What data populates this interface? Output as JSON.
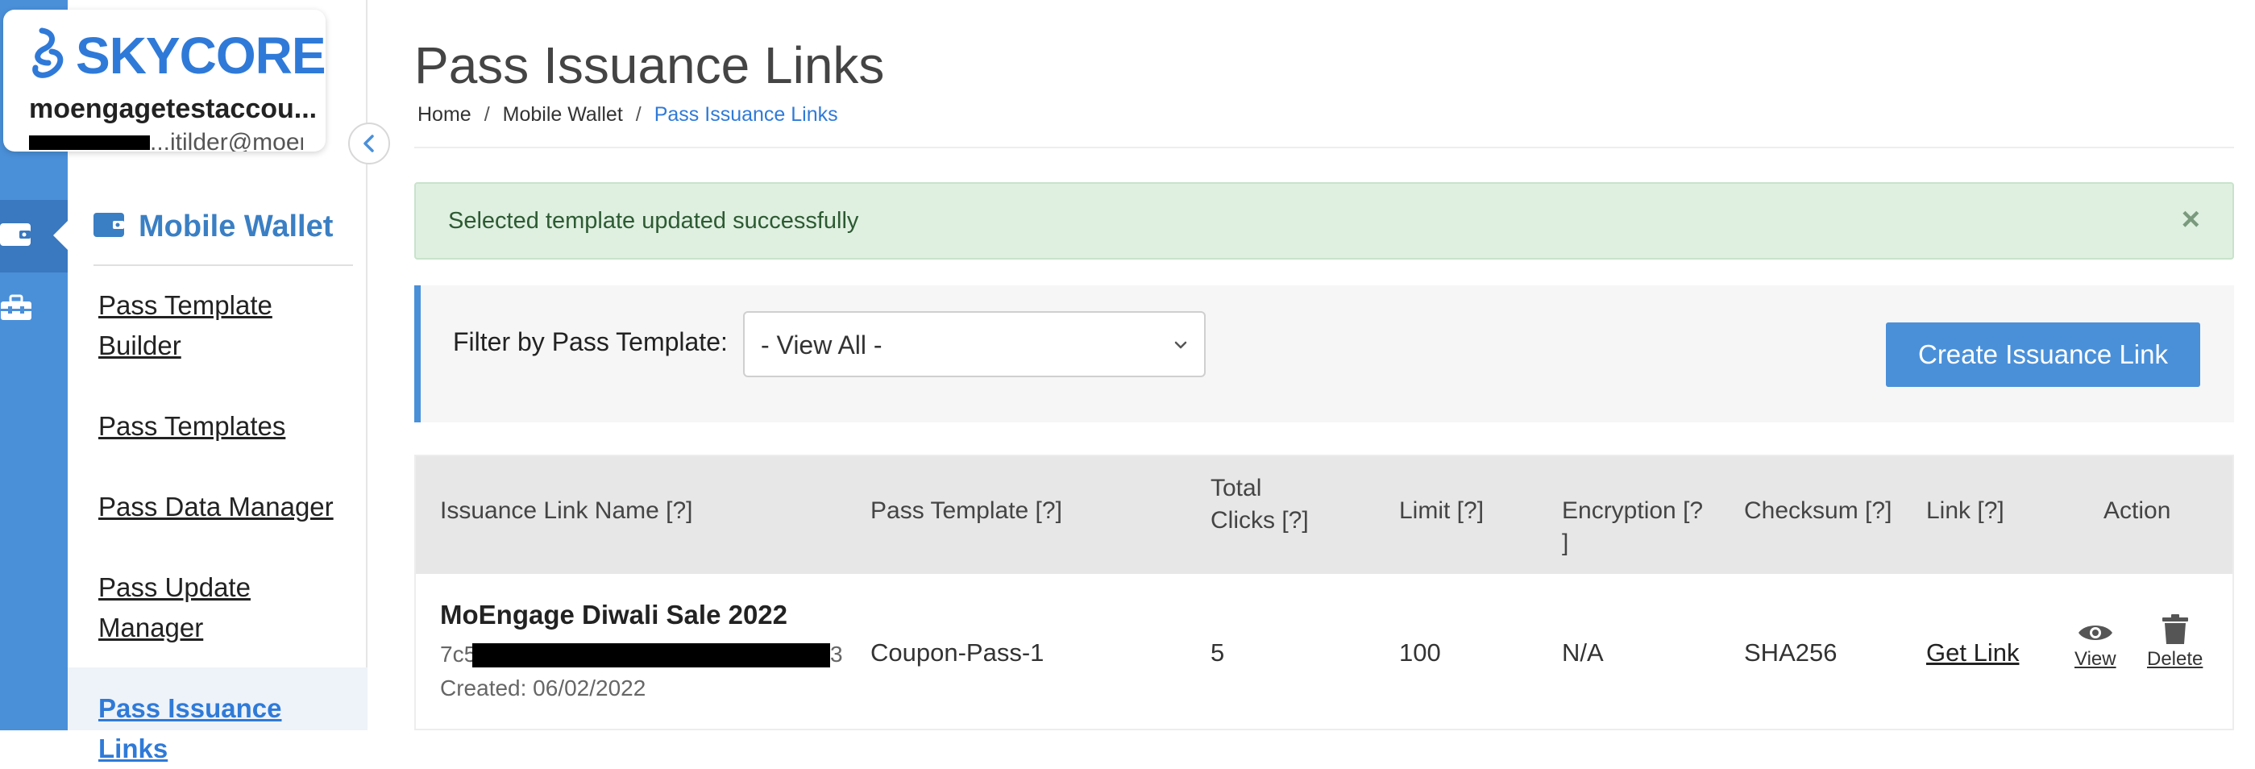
{
  "brand": {
    "logo_text": "SKYCORE",
    "account_name": "moengagetestaccou...",
    "account_sub_visible": "...itilder@moengage..."
  },
  "sidebar": {
    "section_title": "Mobile Wallet",
    "items": [
      {
        "label": "Pass Template Builder"
      },
      {
        "label": "Pass Templates"
      },
      {
        "label": "Pass Data Manager"
      },
      {
        "label": "Pass Update Manager"
      },
      {
        "label": "Pass Issuance Links"
      }
    ]
  },
  "page": {
    "title": "Pass Issuance Links",
    "breadcrumb": [
      "Home",
      "Mobile Wallet",
      "Pass Issuance Links"
    ],
    "breadcrumb_sep": "/"
  },
  "alert": {
    "message": "Selected template updated successfully",
    "close_glyph": "×"
  },
  "filter": {
    "label": "Filter by Pass Template:",
    "selected": "- View All -"
  },
  "create_button": {
    "label": "Create Issuance Link"
  },
  "table": {
    "headers": {
      "name": "Issuance Link Name [?]",
      "template": "Pass Template [?]",
      "clicks_line1": "Total",
      "clicks_line2": "Clicks [?]",
      "limit": "Limit [?]",
      "encryption_line1": "Encryption [?",
      "encryption_line2": "]",
      "checksum": "Checksum [?]",
      "link": "Link [?]",
      "action": "Action"
    },
    "rows": [
      {
        "name": "MoEngage Diwali Sale 2022",
        "id_prefix": "7c5",
        "id_suffix": "3",
        "created": "Created: 06/02/2022",
        "template": "Coupon-Pass-1",
        "clicks": "5",
        "limit": "100",
        "encryption": "N/A",
        "checksum": "SHA256",
        "link": "Get Link",
        "view_label": "View",
        "delete_label": "Delete"
      }
    ]
  },
  "colors": {
    "accent": "#4a90d9",
    "success_bg": "#dff0e1",
    "link_active": "#2f7ad8"
  }
}
